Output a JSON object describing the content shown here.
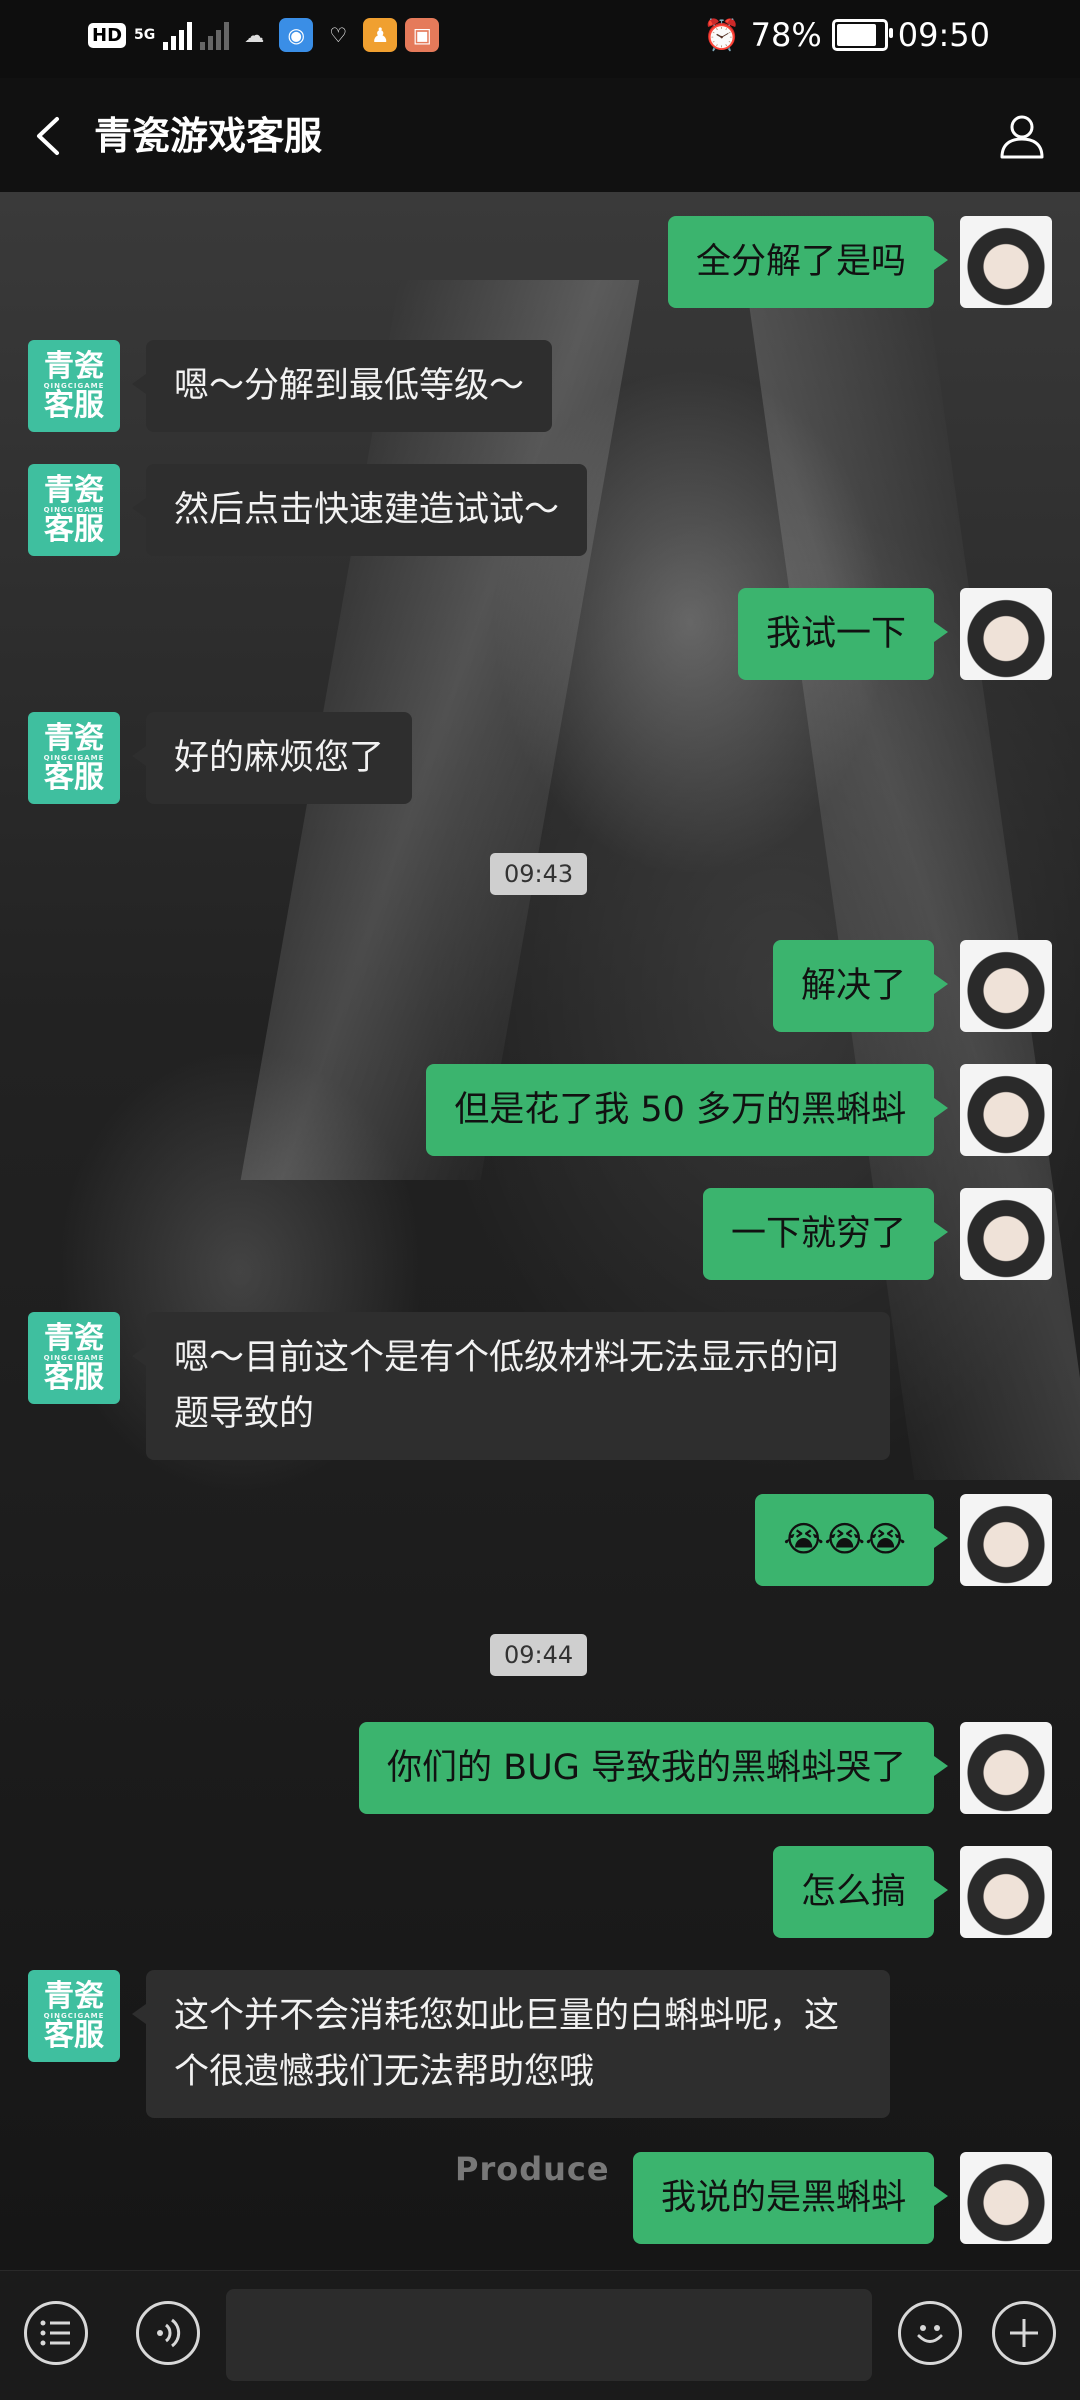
{
  "status_bar": {
    "hd": "HD",
    "network": "5G",
    "battery_percent": "78%",
    "battery_level": 0.78,
    "time": "09:50"
  },
  "header": {
    "title": "青瓷游戏客服"
  },
  "agent_avatar": {
    "line1": "青瓷",
    "line2": "客服",
    "small": "QINGCIGAME"
  },
  "timestamps": [
    "09:43",
    "09:44"
  ],
  "messages": [
    {
      "from": "user",
      "text": "全分解了是吗"
    },
    {
      "from": "agent",
      "text": "嗯～分解到最低等级～"
    },
    {
      "from": "agent",
      "text": "然后点击快速建造试试～"
    },
    {
      "from": "user",
      "text": "我试一下"
    },
    {
      "from": "agent",
      "text": "好的麻烦您了"
    },
    {
      "from": "user",
      "text": "解决了"
    },
    {
      "from": "user",
      "text": "但是花了我 50 多万的黑蝌蚪"
    },
    {
      "from": "user",
      "text": "一下就穷了"
    },
    {
      "from": "agent",
      "text": "嗯～目前这个是有个低级材料无法显示的问题导致的"
    },
    {
      "from": "user",
      "text": "😭😭😭"
    },
    {
      "from": "user",
      "text": "你们的 BUG 导致我的黑蝌蚪哭了"
    },
    {
      "from": "user",
      "text": "怎么搞"
    },
    {
      "from": "agent",
      "text": "这个并不会消耗您如此巨量的白蝌蚪呢，这个很遗憾我们无法帮助您哦"
    },
    {
      "from": "user",
      "text": "我说的是黑蝌蚪"
    }
  ],
  "background": {
    "watermark": "Produce"
  },
  "input": {
    "placeholder": ""
  },
  "colors": {
    "outgoing_bubble": "#3bb46e",
    "incoming_bubble": "#2e2e2e",
    "agent_avatar": "#3fbf9f"
  }
}
